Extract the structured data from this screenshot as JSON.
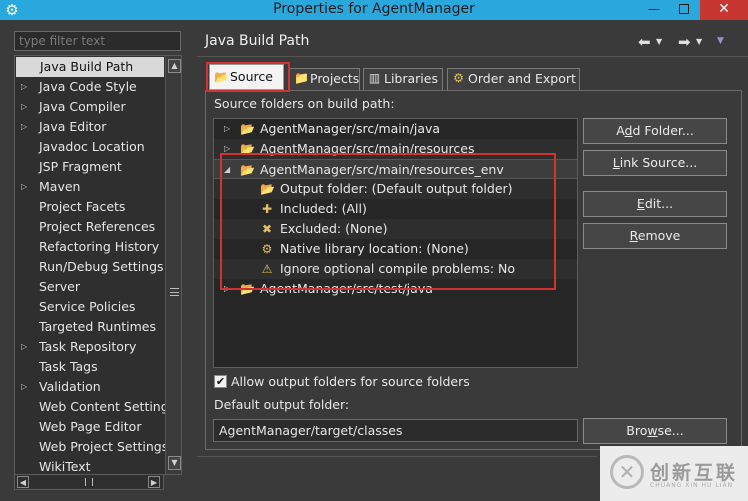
{
  "window": {
    "title": "Properties for AgentManager",
    "close_glyph": "✕",
    "min_glyph": "—"
  },
  "filter": {
    "placeholder": "type filter text"
  },
  "nav": {
    "items": [
      {
        "label": "Java Build Path",
        "expandable": false,
        "selected": true
      },
      {
        "label": "Java Code Style",
        "expandable": true
      },
      {
        "label": "Java Compiler",
        "expandable": true
      },
      {
        "label": "Java Editor",
        "expandable": true
      },
      {
        "label": "Javadoc Location",
        "expandable": false
      },
      {
        "label": "JSP Fragment",
        "expandable": false
      },
      {
        "label": "Maven",
        "expandable": true
      },
      {
        "label": "Project Facets",
        "expandable": false
      },
      {
        "label": "Project References",
        "expandable": false
      },
      {
        "label": "Refactoring History",
        "expandable": false
      },
      {
        "label": "Run/Debug Settings",
        "expandable": false
      },
      {
        "label": "Server",
        "expandable": false
      },
      {
        "label": "Service Policies",
        "expandable": false
      },
      {
        "label": "Targeted Runtimes",
        "expandable": false
      },
      {
        "label": "Task Repository",
        "expandable": true
      },
      {
        "label": "Task Tags",
        "expandable": false
      },
      {
        "label": "Validation",
        "expandable": true
      },
      {
        "label": "Web Content Settings",
        "expandable": false
      },
      {
        "label": "Web Page Editor",
        "expandable": false
      },
      {
        "label": "Web Project Settings",
        "expandable": false
      },
      {
        "label": "WikiText",
        "expandable": false
      }
    ]
  },
  "panel": {
    "title": "Java Build Path",
    "tabs": [
      {
        "label": "Source",
        "icon": "source-folder-icon",
        "active": true
      },
      {
        "label": "Projects",
        "icon": "projects-icon"
      },
      {
        "label": "Libraries",
        "icon": "libraries-icon"
      },
      {
        "label": "Order and Export",
        "icon": "order-export-icon"
      }
    ],
    "source_label": "Source folders on build path:",
    "tree_rows": [
      {
        "text": "AgentManager/src/main/java",
        "level": 0,
        "twisty": "▷",
        "icon": "source-folder-icon"
      },
      {
        "text": "AgentManager/src/main/resources",
        "level": 0,
        "twisty": "▷",
        "icon": "source-folder-icon"
      },
      {
        "text": "AgentManager/src/main/resources_env",
        "level": 0,
        "twisty": "◢",
        "icon": "source-folder-icon",
        "selected": true
      },
      {
        "text": "Output folder: (Default output folder)",
        "level": 1,
        "icon": "output-folder-icon"
      },
      {
        "text": "Included: (All)",
        "level": 1,
        "icon": "inclusion-filter-icon"
      },
      {
        "text": "Excluded: (None)",
        "level": 1,
        "icon": "exclusion-filter-icon"
      },
      {
        "text": "Native library location: (None)",
        "level": 1,
        "icon": "native-library-icon"
      },
      {
        "text": "Ignore optional compile problems: No",
        "level": 1,
        "icon": "ignore-problems-icon"
      },
      {
        "text": "AgentManager/src/test/java",
        "level": 0,
        "twisty": "▷",
        "icon": "source-folder-icon"
      }
    ],
    "buttons": {
      "add_folder": {
        "pre": "A",
        "mn": "d",
        "post": "d Folder..."
      },
      "link_source": {
        "pre": "",
        "mn": "L",
        "post": "ink Source..."
      },
      "edit": {
        "pre": "",
        "mn": "E",
        "post": "dit..."
      },
      "remove": {
        "pre": "",
        "mn": "R",
        "post": "emove"
      },
      "browse": {
        "pre": "Bro",
        "mn": "w",
        "post": "se..."
      }
    },
    "allow_output": {
      "label": "Allow output folders for source folders",
      "checked": true
    },
    "default_output_label": "Default output folder:",
    "default_output_value": "AgentManager/target/classes"
  },
  "watermark": {
    "text": "创新互联",
    "sub": "CHUANG XIN HU LIAN"
  }
}
